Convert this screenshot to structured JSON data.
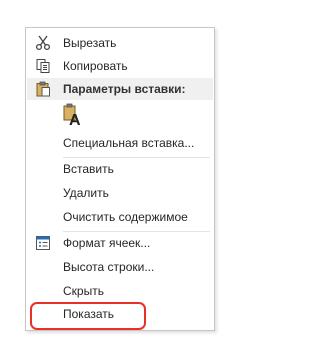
{
  "menu": {
    "cut": "Вырезать",
    "copy": "Копировать",
    "paste_options_header": "Параметры вставки:",
    "paste_values_glyph": "A",
    "paste_special": "Специальная вставка...",
    "insert": "Вставить",
    "delete": "Удалить",
    "clear_contents": "Очистить содержимое",
    "format_cells": "Формат ячеек...",
    "row_height": "Высота строки...",
    "hide": "Скрыть",
    "show": "Показать"
  },
  "highlight_color": "#e8302a"
}
